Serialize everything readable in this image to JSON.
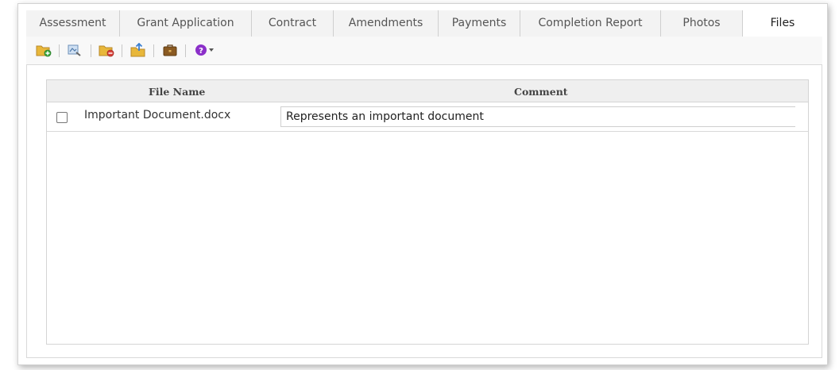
{
  "tabs": [
    {
      "label": "Assessment"
    },
    {
      "label": "Grant Application"
    },
    {
      "label": "Contract"
    },
    {
      "label": "Amendments"
    },
    {
      "label": "Payments"
    },
    {
      "label": "Completion Report"
    },
    {
      "label": "Photos"
    },
    {
      "label": "Files",
      "active": true
    }
  ],
  "toolbar": {
    "icons": [
      "add-folder-icon",
      "scan-icon",
      "remove-folder-icon",
      "upload-folder-icon",
      "briefcase-icon",
      "help-dropdown-icon"
    ]
  },
  "grid": {
    "columns": [
      "File Name",
      "Comment"
    ],
    "rows": [
      {
        "checked": false,
        "file_name": "Important Document.docx",
        "comment": "Represents an important document"
      }
    ]
  },
  "colors": {
    "help_purple": "#8b2fc9",
    "folder_yellow": "#e8b73a",
    "add_green": "#3aa83a",
    "remove_red": "#d9423a"
  }
}
